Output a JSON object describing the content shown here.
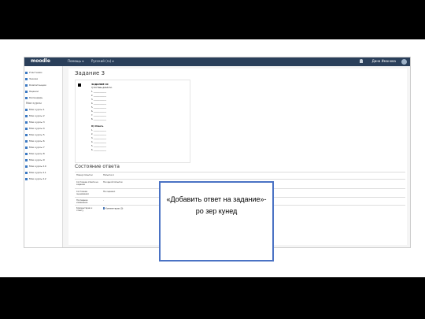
{
  "app": {
    "brand": "moodle",
    "nav": [
      "Помощь ▾",
      "Русский (ru) ▾"
    ],
    "user": "Дина Иманова"
  },
  "sidebar": {
    "items": [
      {
        "label": "Участники"
      },
      {
        "label": "Значки"
      },
      {
        "label": "Компетенции"
      },
      {
        "label": "Оценки"
      },
      {
        "label": "Календарь"
      }
    ],
    "section_head": "Мои курсы",
    "courses": [
      {
        "label": "Мои курсы 1"
      },
      {
        "label": "Мои курсы 2"
      },
      {
        "label": "Мои курсы 3"
      },
      {
        "label": "Мои курсы 4"
      },
      {
        "label": "Мои курсы 5"
      },
      {
        "label": "Мои курсы 6"
      },
      {
        "label": "Мои курсы 7"
      },
      {
        "label": "Мои курсы 8"
      },
      {
        "label": "Мои курсы 9"
      },
      {
        "label": "Мои курсы 10"
      },
      {
        "label": "Мои курсы 11"
      },
      {
        "label": "Мои курсы 12"
      }
    ]
  },
  "main": {
    "title": "Задание 3",
    "question": {
      "task": "ЗАДАНИЕ III:",
      "subtitle": "I) Составь диалоги.",
      "lines": [
        "1. ______________",
        "2. ______________",
        "3. ______________",
        "4. ______________",
        "5. ______________",
        "6. ______________",
        "7. ______________",
        "8. ______________"
      ],
      "section2": "II) Ответь",
      "lines2": [
        "1. ______________",
        "2. ______________",
        "3. ______________",
        "4. ______________",
        "5. ______________",
        "6. ______________"
      ]
    },
    "status_title": "Состояние ответа",
    "status_rows": [
      {
        "key": "Номер попытки",
        "value": "Попытка 1"
      },
      {
        "key": "Состояние ответа на задание",
        "value": "Ни одной попытки"
      },
      {
        "key": "Состояние оценивания",
        "value": "Не оценено"
      },
      {
        "key": "Последнее изменение",
        "value": "-"
      },
      {
        "key": "Комментарии к ответу",
        "value": "Комментарии (0)"
      }
    ],
    "add_button": "Добавить ответ на задание",
    "note": "Вы еще не представили ответ на задание"
  },
  "callout": {
    "text": "«Добавить ответ на задание»-ро зер кунед"
  }
}
